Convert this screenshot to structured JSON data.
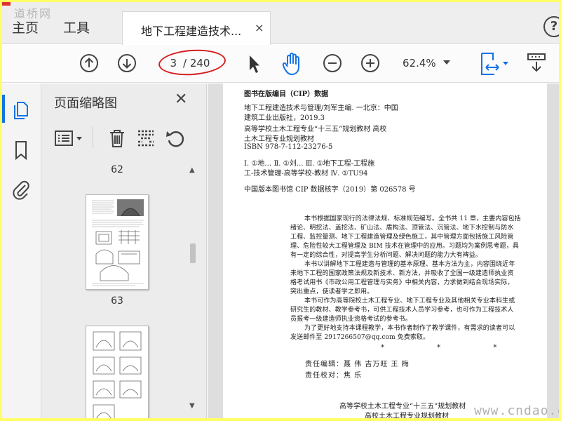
{
  "tabbar": {
    "home_label": "主页",
    "tools_label": "工具",
    "doc_tab_title": "地下工程建造技术...",
    "doc_tab_close": "×",
    "help": "?",
    "watermark": "道桥网"
  },
  "toolbar": {
    "icons": [
      "prev-page-icon",
      "next-page-icon",
      "select-cursor-icon",
      "hand-icon",
      "zoom-out-icon",
      "zoom-in-icon",
      "fit-width-icon",
      "scroll-mode-icon"
    ],
    "current_page": "3",
    "total_pages": "/ 240",
    "zoom": "62.4%",
    "annotation_color": "#d61f1f"
  },
  "left_rail": {
    "icons": [
      "page-thumbnails-icon",
      "bookmark-icon",
      "attachment-icon"
    ],
    "accent": "#1473e6"
  },
  "thumbnail_panel": {
    "title": "页面缩略图",
    "close": "✕",
    "tools": [
      "page-options-icon",
      "delete-icon",
      "extract-icon",
      "rotate-icon"
    ],
    "pages": [
      "62",
      "63"
    ]
  },
  "document": {
    "cip_title": "图书在版编目（CIP）数据",
    "cip_lines": [
      "地下工程建造技术与管理/刘军主编. 一北京：中国",
      "建筑工业出版社，2019.3",
      "高等学校土木工程专业“十三五”规划教材  高校",
      "土木工程专业规划教材",
      "ISBN 978-7-112-23276-5",
      "Ⅰ. ①地…  Ⅱ. ①刘…  Ⅲ. ①地下工程-工程施",
      "工-技术管理-高等学校-教材  Ⅳ. ①TU94",
      "中国版本图书馆 CIP 数据核字（2019）第 026578 号"
    ],
    "body_lines": [
      "本书根据国家现行的法律法规、标准规范编写。全书共 11 章，主要内容包括",
      "绪论、明挖法、盖挖法、矿山法、盾构法、顶管法、沉管法、地下水控制与防水",
      "工程、监控量测、地下工程建造管理及绿色施工，其中管理方面包括施工风险管",
      "理、危险性较大工程管理及 BIM 技术在管理中的应用。习题均为案例思考题，具",
      "有一定的综合性，对提高学生分析问题、解决问题的能力大有裨益。",
      "本书以讲解地下工程建造与管理的基本原理、基本方法为主，内容围绕近年",
      "来地下工程的国家政策法规及新技术、新方法，并吸收了全国一级建造师执业资",
      "格考试用书《市政公用工程管理与实务》中相关内容，力求做到结合现场实际，",
      "突出重点，使读者学之即用。",
      "本书可作为高等院校土木工程专业、地下工程专业及其他相关专业本科生或",
      "研究生的教材、教学参考书，可供工程技术人员学习参考，也可作为工程技术人",
      "员报考一级建造师执业资格考试的参考书。",
      "为了更好地支持本课程教学，本书作者制作了教学课件，有需求的读者可以",
      "发送邮件至 2917266507@qq.com 免费索取。"
    ],
    "stars": "* * *",
    "editors": [
      "责任编辑：聂  伟  吉万旺  王  梅",
      "责任校对：焦  乐"
    ],
    "footer": [
      "高等学校土木工程专业“十三五”规划教材",
      "高校土木工程专业规划教材"
    ],
    "site_watermark": "www.cndao.com"
  }
}
